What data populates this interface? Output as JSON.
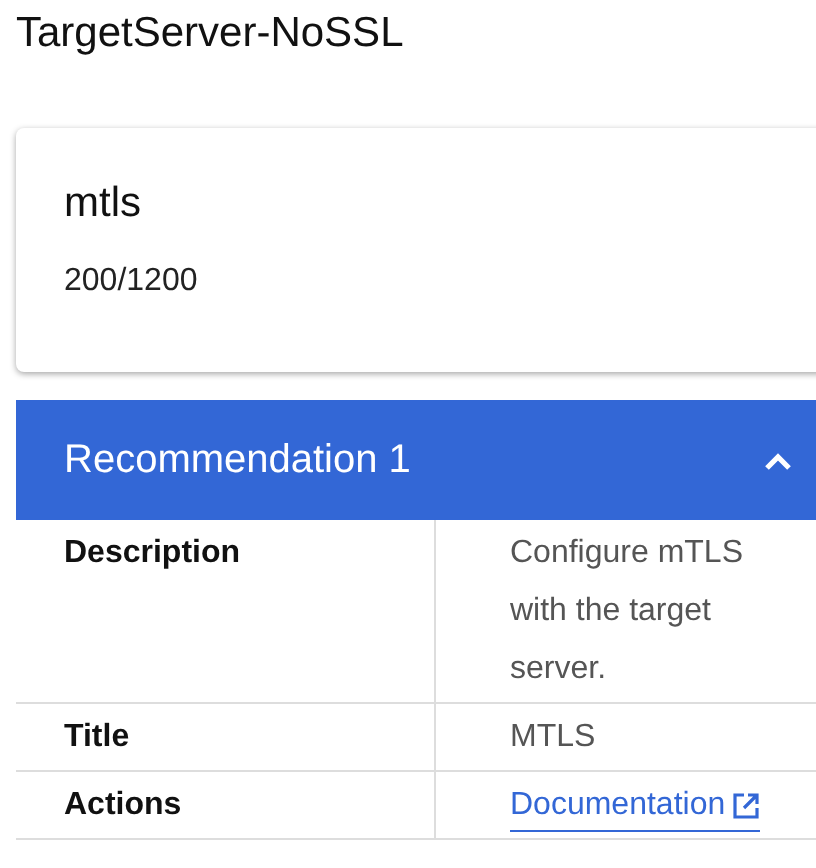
{
  "page_title": "TargetServer-NoSSL",
  "score_card": {
    "name": "mtls",
    "score": "200/1200"
  },
  "recommendation": {
    "title": "Recommendation 1",
    "expanded": true,
    "rows": [
      {
        "label": "Description",
        "kind": "text",
        "value": "Configure mTLS with the target server."
      },
      {
        "label": "Title",
        "kind": "text",
        "value": "MTLS"
      },
      {
        "label": "Actions",
        "kind": "link",
        "value": "Documentation"
      }
    ]
  }
}
